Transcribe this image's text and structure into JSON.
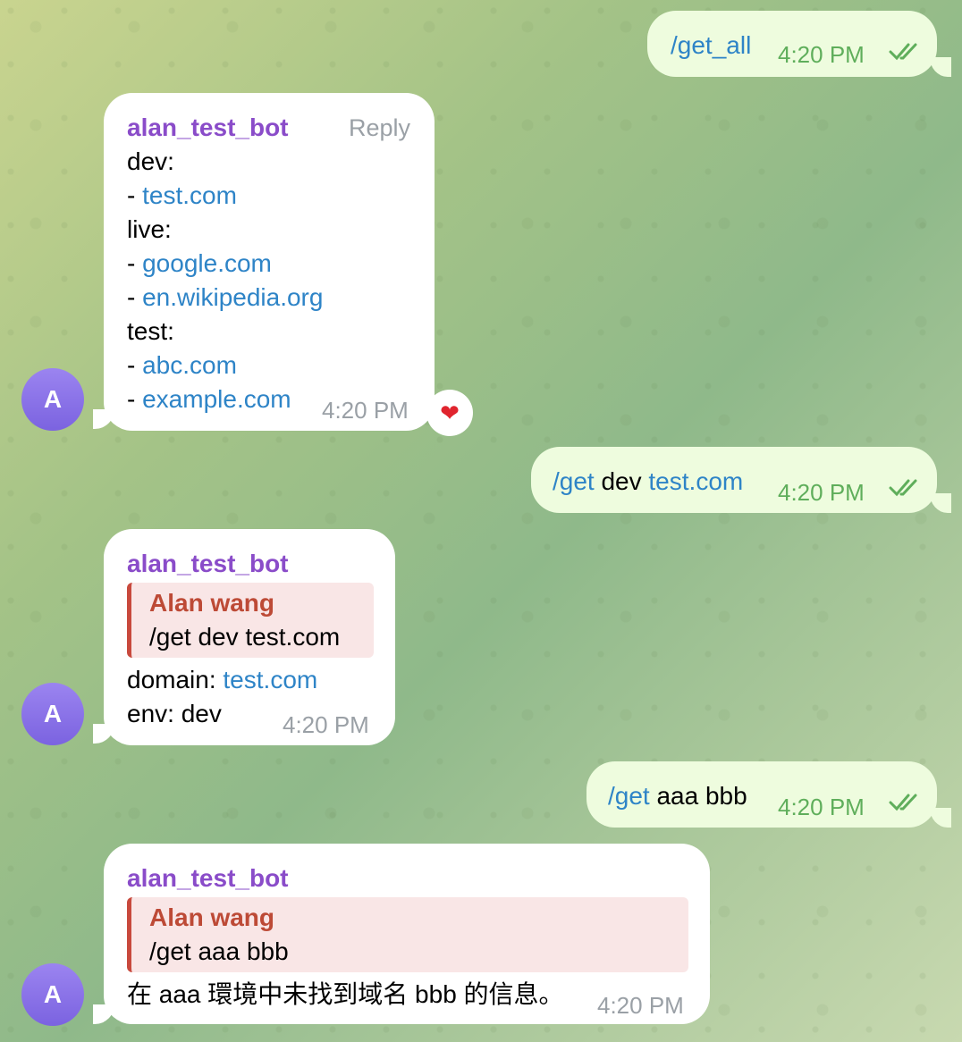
{
  "outgoing": [
    {
      "cmd": "/get_all",
      "rest": "",
      "link": "",
      "time": "4:20 PM"
    },
    {
      "cmd": "/get",
      "rest": " dev ",
      "link": "test.com",
      "time": "4:20 PM"
    },
    {
      "cmd": "/get",
      "rest": " aaa bbb",
      "link": "",
      "time": "4:20 PM"
    }
  ],
  "bot_name": "alan_test_bot",
  "avatar_letter": "A",
  "msg1": {
    "reply_label": "Reply",
    "lines": {
      "dev_label": "dev:",
      "dash1": "- ",
      "link1": "test.com",
      "live_label": "live:",
      "dash2": "- ",
      "link2": "google.com",
      "dash3": "- ",
      "link3": "en.wikipedia.org",
      "test_label": "test:",
      "dash4": "- ",
      "link4": "abc.com",
      "dash5": "- ",
      "link5": "example.com"
    },
    "time": "4:20 PM",
    "reaction": "heart"
  },
  "msg2": {
    "quote_author": "Alan wang",
    "quote_text": "/get dev test.com",
    "domain_label": "domain: ",
    "domain_link": "test.com",
    "env_line": "env: dev",
    "time": "4:20 PM"
  },
  "msg3": {
    "quote_author": "Alan wang",
    "quote_text": "/get aaa bbb",
    "body": "在 aaa 環境中未找到域名 bbb 的信息。",
    "time": "4:20 PM"
  },
  "colors": {
    "outgoing_bubble": "#eefcde",
    "incoming_bubble": "#ffffff",
    "link": "#2e84c7",
    "sender": "#8a4cc9",
    "quote_author": "#bd4a36",
    "check_marks": "#5fae5b"
  }
}
